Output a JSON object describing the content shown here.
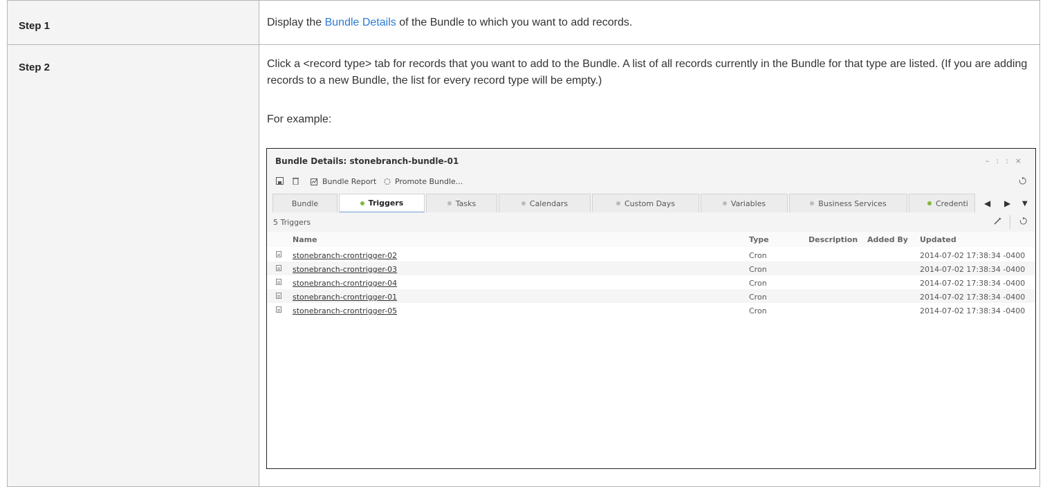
{
  "steps": [
    {
      "label": "Step 1",
      "text_before": "Display the ",
      "link": "Bundle Details",
      "text_after": " of the Bundle to which you want to add records."
    },
    {
      "label": "Step 2",
      "text": "Click a <record type> tab for records that you want to add to the Bundle. A list of all records currently in the Bundle for that type are listed. (If you are adding records to a new Bundle, the list for every record type will be empty.)",
      "example": "For example:"
    }
  ],
  "window": {
    "title": "Bundle Details: stonebranch-bundle-01",
    "controls": "– :: ×",
    "toolbar": {
      "bundle_report": "Bundle Report",
      "promote_bundle": "Promote Bundle..."
    },
    "tabs": [
      {
        "label": "Bundle",
        "dot": "none"
      },
      {
        "label": "Triggers",
        "dot": "green",
        "active": true
      },
      {
        "label": "Tasks",
        "dot": "grey"
      },
      {
        "label": "Calendars",
        "dot": "grey"
      },
      {
        "label": "Custom Days",
        "dot": "grey"
      },
      {
        "label": "Variables",
        "dot": "grey"
      },
      {
        "label": "Business Services",
        "dot": "grey"
      },
      {
        "label": "Credenti",
        "dot": "green"
      }
    ],
    "count_label": "5 Triggers",
    "columns": [
      "Name",
      "Type",
      "Description",
      "Added By",
      "Updated"
    ],
    "rows": [
      {
        "name": "stonebranch-crontrigger-02",
        "type": "Cron",
        "description": "",
        "added_by": "",
        "updated": "2014-07-02 17:38:34 -0400"
      },
      {
        "name": "stonebranch-crontrigger-03",
        "type": "Cron",
        "description": "",
        "added_by": "",
        "updated": "2014-07-02 17:38:34 -0400"
      },
      {
        "name": "stonebranch-crontrigger-04",
        "type": "Cron",
        "description": "",
        "added_by": "",
        "updated": "2014-07-02 17:38:34 -0400"
      },
      {
        "name": "stonebranch-crontrigger-01",
        "type": "Cron",
        "description": "",
        "added_by": "",
        "updated": "2014-07-02 17:38:34 -0400"
      },
      {
        "name": "stonebranch-crontrigger-05",
        "type": "Cron",
        "description": "",
        "added_by": "",
        "updated": "2014-07-02 17:38:34 -0400"
      }
    ],
    "colors": {
      "active_tab_underline": "#6c9fd6",
      "record_dot": "#84b83b"
    }
  }
}
